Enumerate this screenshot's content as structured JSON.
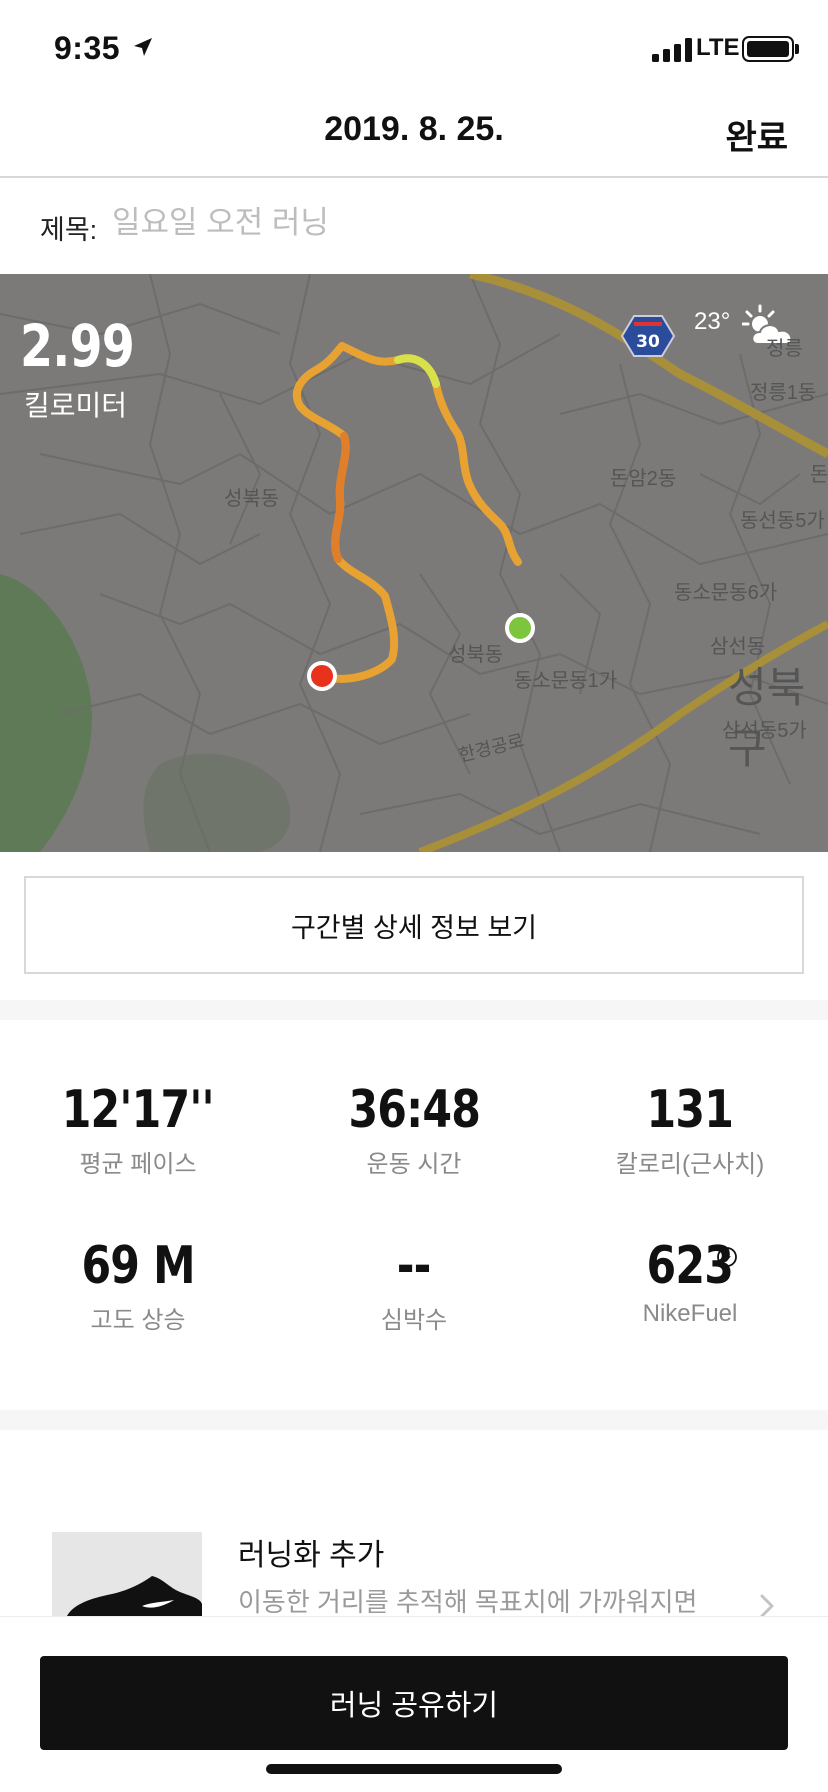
{
  "status_bar": {
    "time": "9:35",
    "network": "LTE"
  },
  "nav": {
    "date": "2019. 8. 25.",
    "done_label": "완료"
  },
  "title_field": {
    "label": "제목:",
    "placeholder": "일요일 오전 러닝"
  },
  "map": {
    "distance": "2.99",
    "distance_unit": "킬로미터",
    "temperature": "23°",
    "road_sign": "30",
    "labels": {
      "jeongneung": "정릉",
      "jeongneung1": "정릉1동",
      "donam2": "돈암2동",
      "don": "돈",
      "seongbuk_a": "성북동",
      "seongbuk_b": "성북동",
      "dongseon5": "동선동5가",
      "dongsomun6": "동소문동6가",
      "samseon": "삼선동",
      "dongsomun1": "동소문동1가",
      "seongbuk_big": "성북구",
      "samseon5": "삼선동5가",
      "hangyeong": "한경공로"
    },
    "colors": {
      "background": "#7b7a79",
      "route": "#e8a232",
      "start": "#7bc63c",
      "end": "#e8321c",
      "park": "#5f7a57"
    }
  },
  "segments_button": "구간별 상세 정보 보기",
  "stats": {
    "pace": {
      "value": "12'17''",
      "label": "평균 페이스"
    },
    "duration": {
      "value": "36:48",
      "label": "운동 시간"
    },
    "calories": {
      "value": "131",
      "label": "칼로리(근사치)"
    },
    "elevation": {
      "value": "69 M",
      "label": "고도 상승"
    },
    "heart_rate": {
      "value": "--",
      "label": "심박수"
    },
    "nikefuel": {
      "value": "623",
      "label": "NikeFuel"
    }
  },
  "shoe": {
    "title": "러닝화 추가",
    "description": "이동한 거리를 추적해 목표치에 가까워지면"
  },
  "share_button": "러닝 공유하기"
}
